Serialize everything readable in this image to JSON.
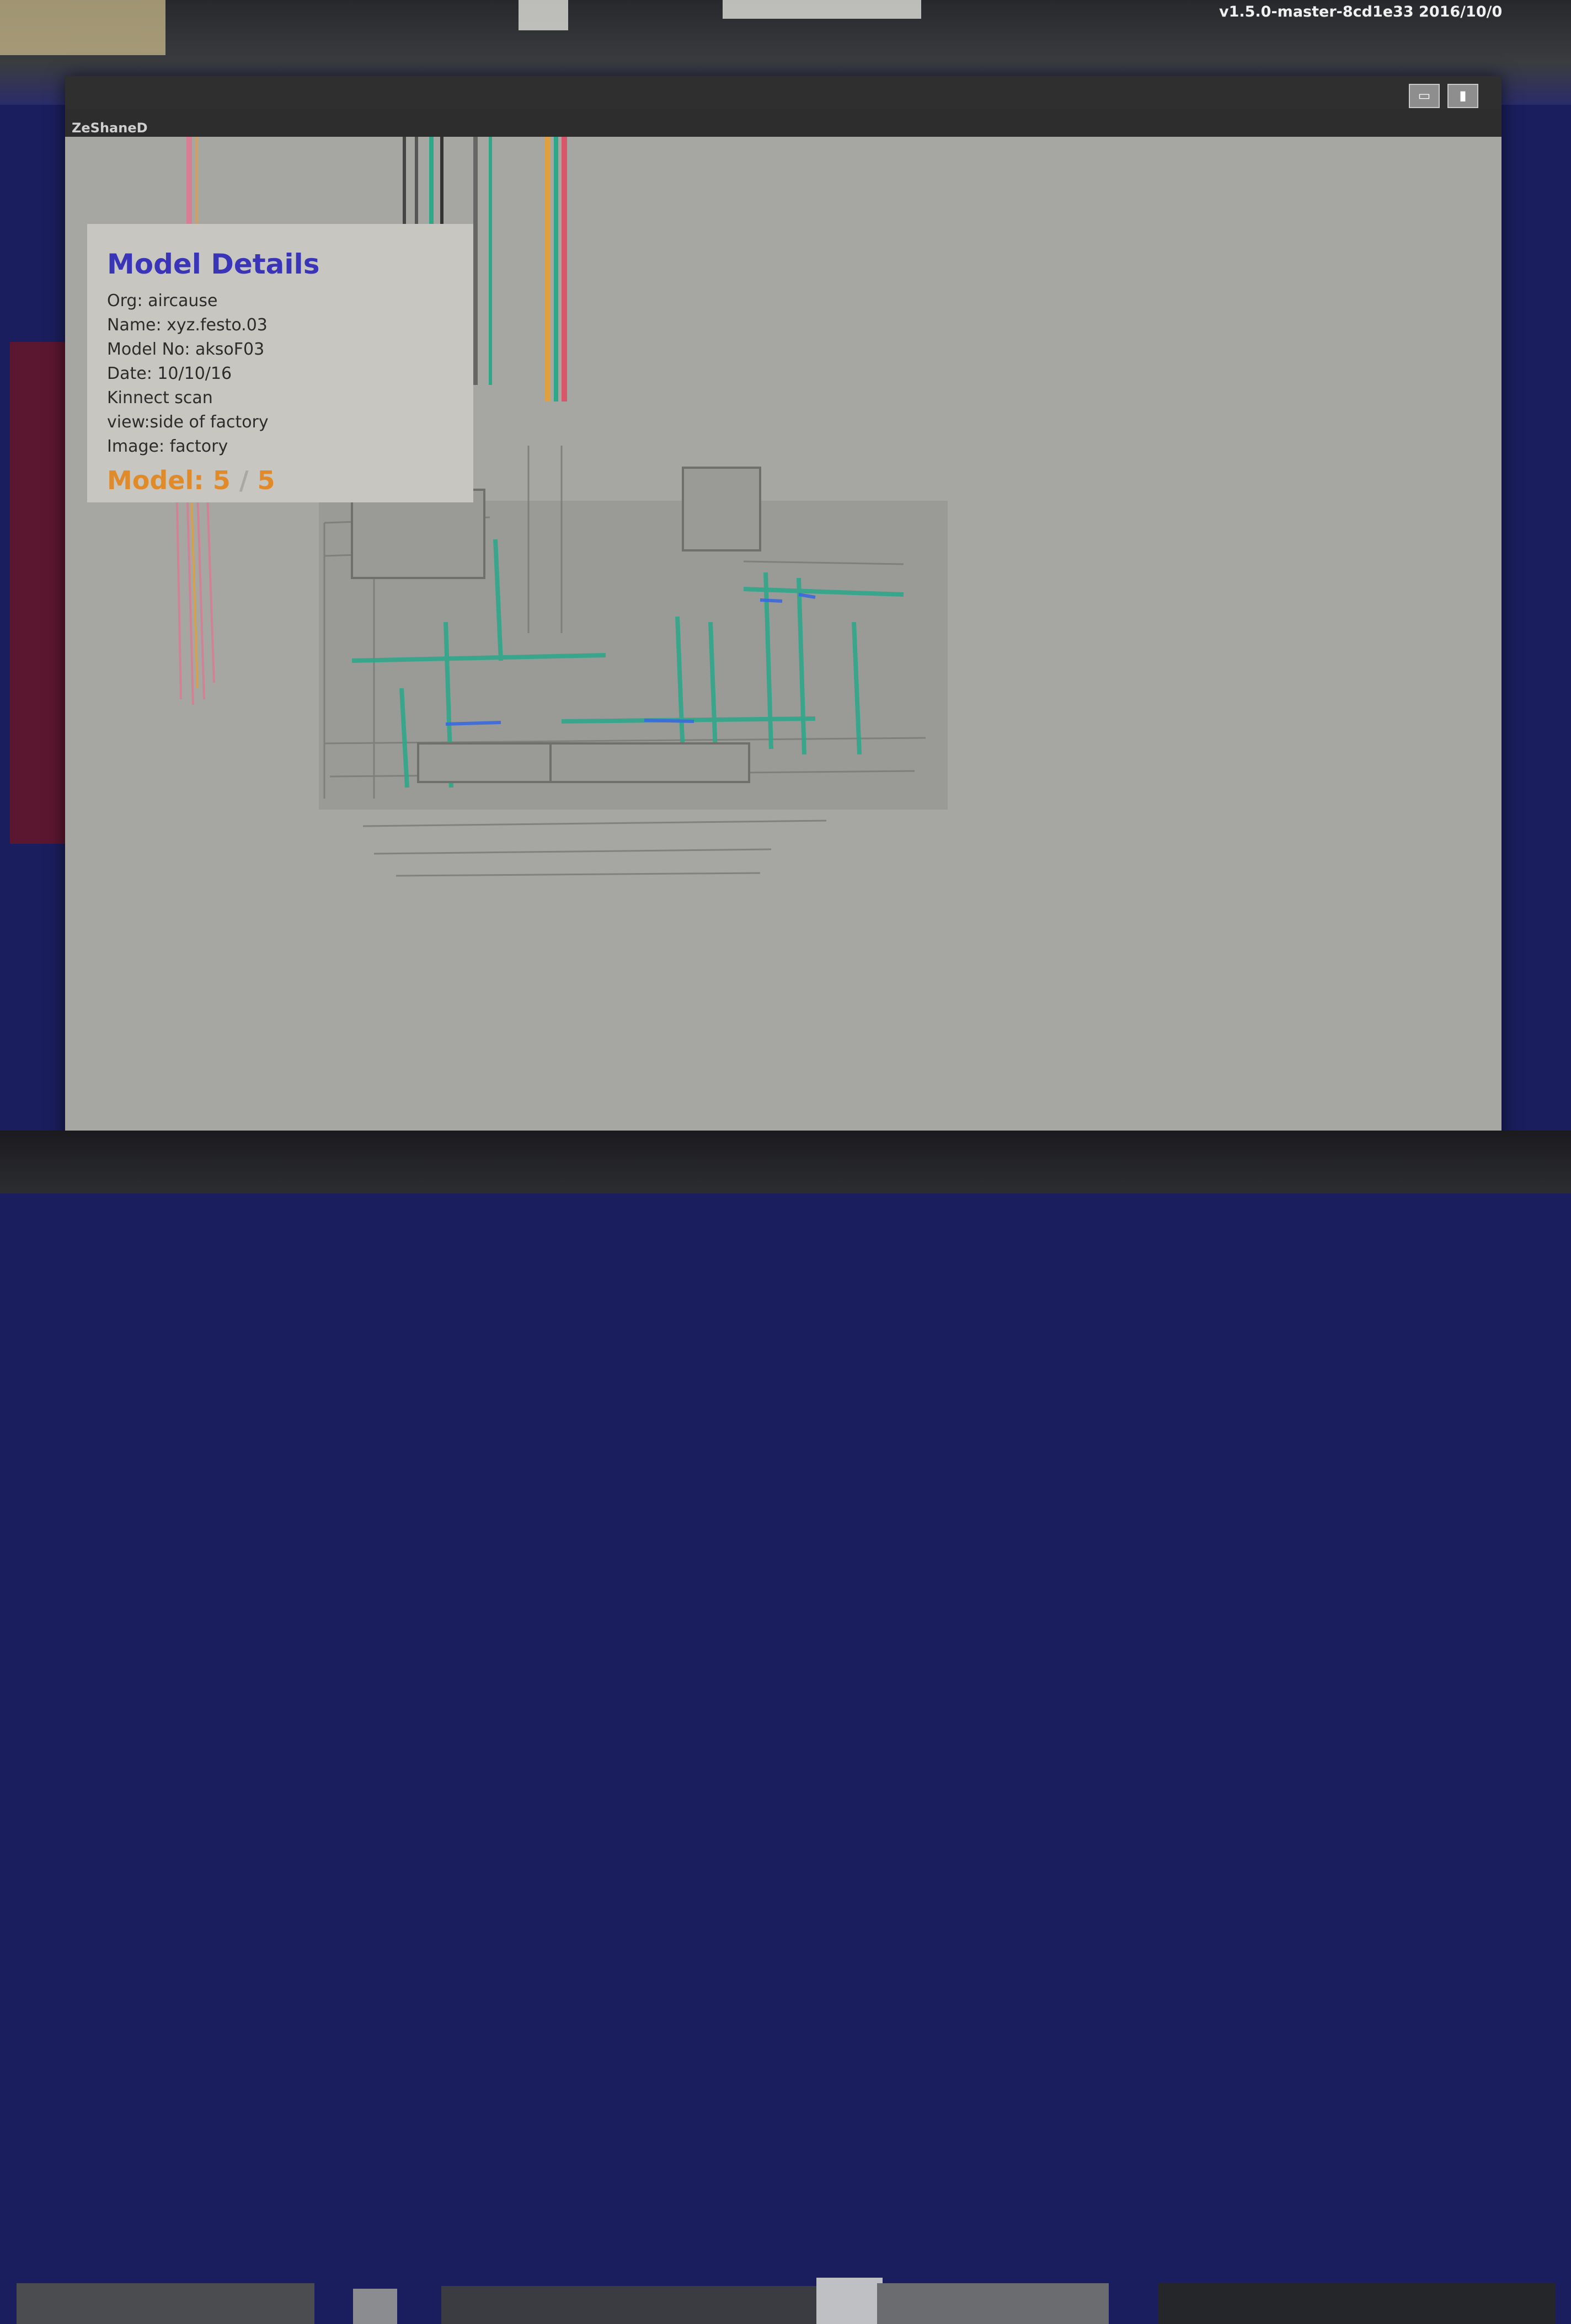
{
  "desktop": {
    "status_text": "v1.5.0-master-8cd1e33 2016/10/0"
  },
  "window": {
    "title": "ZeShaneD",
    "controls": {
      "maximize_glyph": "▭",
      "close_glyph": "▮"
    }
  },
  "details_panel": {
    "title": "Model Details",
    "lines": [
      "Org: aircause",
      "Name: xyz.festo.03",
      "Model No: aksoF03",
      "Date: 10/10/16",
      "Kinnect scan",
      "view:side of factory",
      "Image: factory"
    ],
    "model_label": "Model:",
    "model_current": "5",
    "model_separator": "/",
    "model_total": "5"
  },
  "colors": {
    "title": "#3a35b8",
    "model_counter": "#e08a2a",
    "viewport_bg": "#a6a6a2",
    "points_green": "#2fa88a",
    "points_grey": "#7d7d7a",
    "points_pink": "#d97d94"
  }
}
